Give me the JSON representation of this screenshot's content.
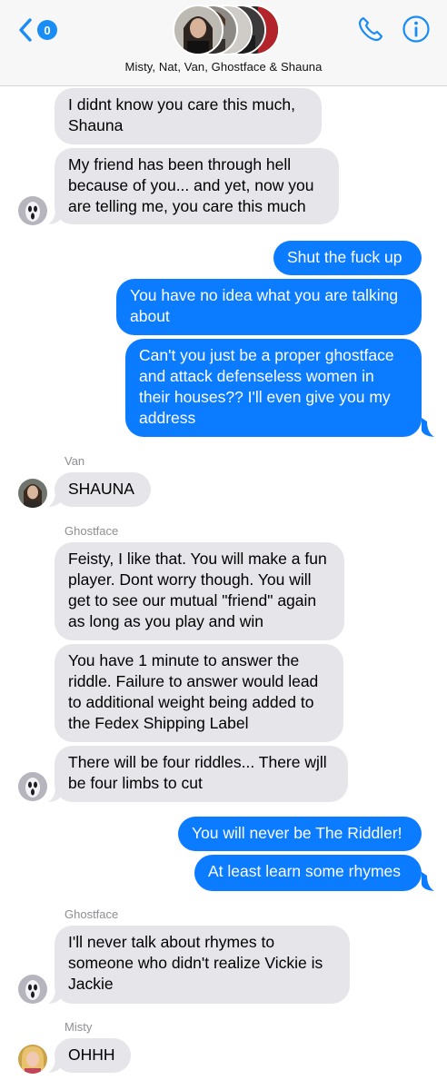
{
  "header": {
    "back_count": "0",
    "title": "Misty, Nat, Van, Ghostface & Shauna",
    "phone_icon": "phone-icon",
    "info_icon": "info-icon"
  },
  "colors": {
    "incoming_bubble": "#e5e5ea",
    "outgoing_bubble": "#0b7bff",
    "accent": "#1a8cf6"
  },
  "messages": [
    {
      "direction": "incoming",
      "text": "I didnt know you care this much,\nShauna"
    },
    {
      "direction": "incoming",
      "text": "My friend has been through hell\nbecause of you... and yet, now you\nare telling me, you care this much",
      "avatar": "ghostface"
    },
    {
      "direction": "outgoing",
      "text": "Shut the fuck up"
    },
    {
      "direction": "outgoing",
      "text": "You have no idea what you are talking\nabout"
    },
    {
      "direction": "outgoing",
      "text": "Can't you just be a proper ghostface\nand attack defenseless women in\ntheir houses?? I'll even give you my\naddress"
    },
    {
      "direction": "incoming",
      "sender": "Van",
      "text": "SHAUNA",
      "avatar": "van"
    },
    {
      "direction": "incoming",
      "sender": "Ghostface",
      "text": "Feisty, I like that. You will make a fun\nplayer. Dont worry though. You will\nget to see our mutual \"friend\" again\nas long as you play and win"
    },
    {
      "direction": "incoming",
      "text": "You have 1 minute to answer the\nriddle. Failure to answer would lead\nto additional weight being added to\nthe Fedex Shipping Label"
    },
    {
      "direction": "incoming",
      "text": "There will be four riddles... There wjll\nbe four limbs to cut",
      "avatar": "ghostface"
    },
    {
      "direction": "outgoing",
      "text": "You will never be The Riddler!"
    },
    {
      "direction": "outgoing",
      "text": "At least learn some rhymes"
    },
    {
      "direction": "incoming",
      "sender": "Ghostface",
      "text": "I'll never talk about rhymes to\nsomeone who didn't realize Vickie is\nJackie",
      "avatar": "ghostface"
    },
    {
      "direction": "incoming",
      "sender": "Misty",
      "text": "OHHH",
      "avatar": "misty"
    }
  ]
}
